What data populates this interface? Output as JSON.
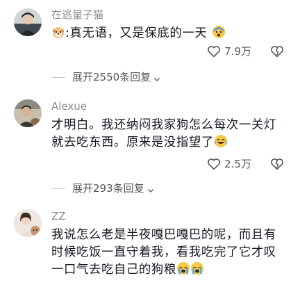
{
  "comments": [
    {
      "username": "在逃量子猫",
      "lines": [
        "真无语，又是保底的一天"
      ],
      "prefix": ":",
      "likes": "7.9万",
      "replies": "展开2550条回复"
    },
    {
      "username": "Alexue",
      "lines": [
        "才明白。我还纳闷我家狗怎么每次一关灯",
        "就去吃东西。原来是没指望了"
      ],
      "likes": "2.5万",
      "replies": "展开293条回复"
    },
    {
      "username": "ZZ",
      "lines": [
        "我说怎么老是半夜嘎巴嘎巴的呢，而且有",
        "时候吃饭一直守着我，看我吃完了它才叹",
        "一口气去吃自己的狗粮"
      ]
    }
  ],
  "colors": {
    "text": "#161823",
    "meta": "#8a8b91",
    "icon": "#55565c"
  }
}
